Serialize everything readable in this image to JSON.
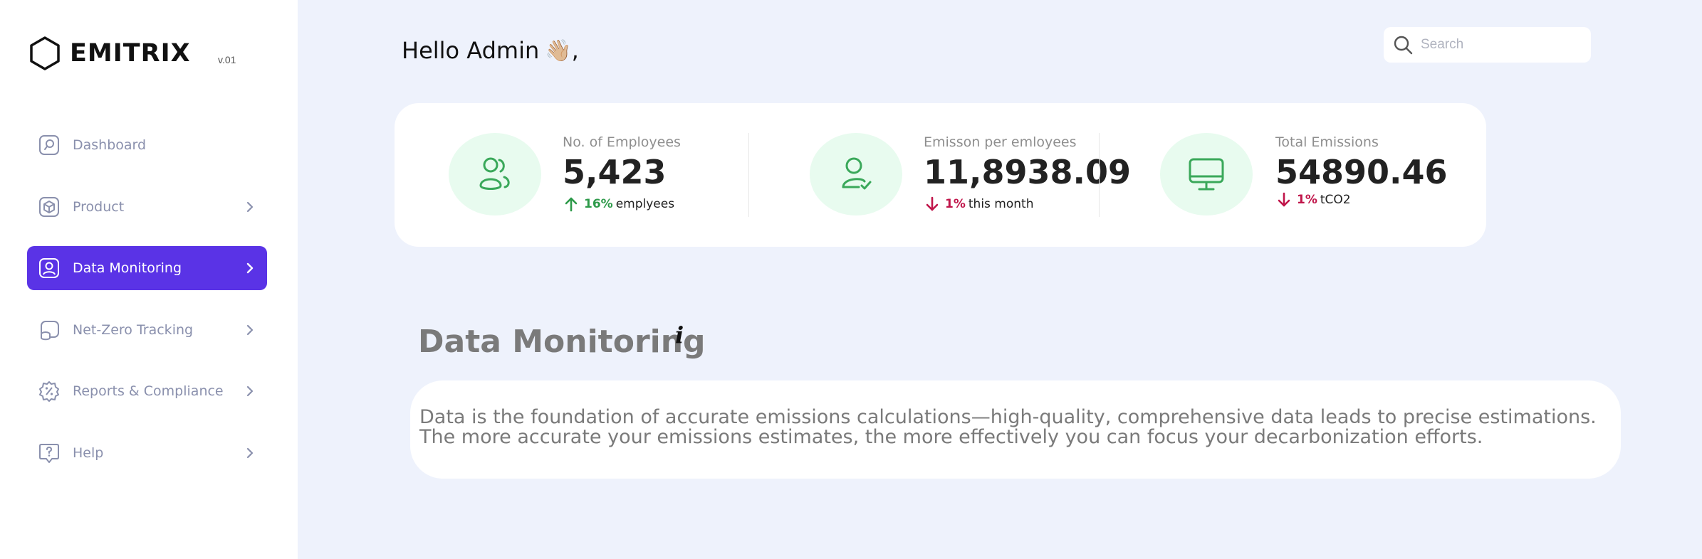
{
  "brand": {
    "name": "EMITRIX",
    "version": "v.01"
  },
  "sidebar": {
    "items": [
      {
        "label": "Dashboard",
        "icon": "search-square-icon",
        "has_chevron": false,
        "active": false
      },
      {
        "label": "Product",
        "icon": "box-icon",
        "has_chevron": true,
        "active": false
      },
      {
        "label": "Data Monitoring",
        "icon": "user-square-icon",
        "has_chevron": true,
        "active": true
      },
      {
        "label": "Net-Zero Tracking",
        "icon": "coins-icon",
        "has_chevron": true,
        "active": false
      },
      {
        "label": "Reports & Compliance",
        "icon": "badge-percent-icon",
        "has_chevron": true,
        "active": false
      },
      {
        "label": "Help",
        "icon": "help-message-icon",
        "has_chevron": true,
        "active": false
      }
    ]
  },
  "header": {
    "greeting": "Hello Admin",
    "wave": "👋🏼",
    "comma": ",",
    "search_placeholder": "Search"
  },
  "stats": [
    {
      "label": "No. of Employees",
      "value": "5,423",
      "trend_direction": "up",
      "trend_pct": "16%",
      "trend_text": "emplyees",
      "icon": "users-icon"
    },
    {
      "label": "Emisson per emloyees",
      "value": "11,8938.09",
      "trend_direction": "down",
      "trend_pct": "1%",
      "trend_text": "this month",
      "icon": "user-check-icon"
    },
    {
      "label": "Total Emissions",
      "value": "54890.46",
      "trend_direction": "down",
      "trend_pct": "1%",
      "trend_text": "tCO2",
      "icon": "monitor-icon"
    }
  ],
  "section": {
    "title": "Data Monitoring",
    "info_glyph": "i",
    "description": "Data is the foundation of accurate emissions calculations—high-quality, comprehensive data leads to precise estimations. The more accurate your emissions estimates, the more effectively you can focus your decarbonization efforts."
  },
  "colors": {
    "accent": "#5a33e6",
    "background": "#eef2fc",
    "positive": "#2e9a4a",
    "negative": "#c0154a",
    "icon_circle": "#e8fbef",
    "icon_stroke": "#3aa85a"
  }
}
